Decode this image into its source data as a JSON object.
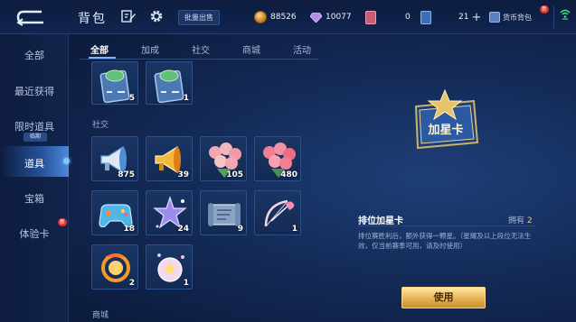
{
  "header": {
    "title": "背包",
    "bulk_sell": "批量出售",
    "currencies": [
      {
        "icon": "gold-coin-icon",
        "value": "88526"
      },
      {
        "icon": "diamond-icon",
        "value": "10077"
      },
      {
        "icon": "ticket-icon",
        "value": "0"
      },
      {
        "icon": "card-icon",
        "value": "21"
      }
    ],
    "currency_bag": "货币背包",
    "new_badge": "新"
  },
  "sidebar": {
    "items": [
      {
        "label": "全部"
      },
      {
        "label": "最近获得"
      },
      {
        "label": "限时道具",
        "tag": "临期"
      },
      {
        "label": "道具"
      },
      {
        "label": "宝箱"
      },
      {
        "label": "体验卡",
        "badge": "新"
      }
    ],
    "active_index": 3
  },
  "tabs": [
    "全部",
    "加成",
    "社交",
    "商城",
    "活动"
  ],
  "active_tab": 0,
  "sections": [
    {
      "label": "",
      "items": [
        {
          "icon": "exp-card-icon",
          "count": "5"
        },
        {
          "icon": "exp-card-icon",
          "count": "1"
        }
      ]
    },
    {
      "label": "社交",
      "items": [
        {
          "icon": "loudspeaker-icon",
          "count": "875"
        },
        {
          "icon": "golden-loudspeaker-icon",
          "count": "39"
        },
        {
          "icon": "rose-bouquet-icon",
          "count": "105"
        },
        {
          "icon": "rose-bouquet-large-icon",
          "count": "480"
        },
        {
          "icon": "game-controller-icon",
          "count": "18"
        },
        {
          "icon": "shooting-star-icon",
          "count": "24"
        },
        {
          "icon": "scroll-letter-icon",
          "count": "9"
        },
        {
          "icon": "cupid-bow-icon",
          "count": "1"
        },
        {
          "icon": "fire-ring-icon",
          "count": "2"
        },
        {
          "icon": "starry-orb-icon",
          "count": "1"
        }
      ]
    },
    {
      "label": "商城",
      "items": []
    }
  ],
  "detail": {
    "card_text": "加星卡",
    "title": "排位加星卡",
    "owned_label": "拥有",
    "owned_count": "2",
    "description": "排位赛胜利后，额外获得一颗星。（星耀及以上段位无法生效，仅当前赛季可用，请及时使用）",
    "use_label": "使用"
  },
  "colors": {
    "accent": "#72b6ff",
    "use_button": "#e4b256",
    "badge_red": "#d8312d"
  }
}
